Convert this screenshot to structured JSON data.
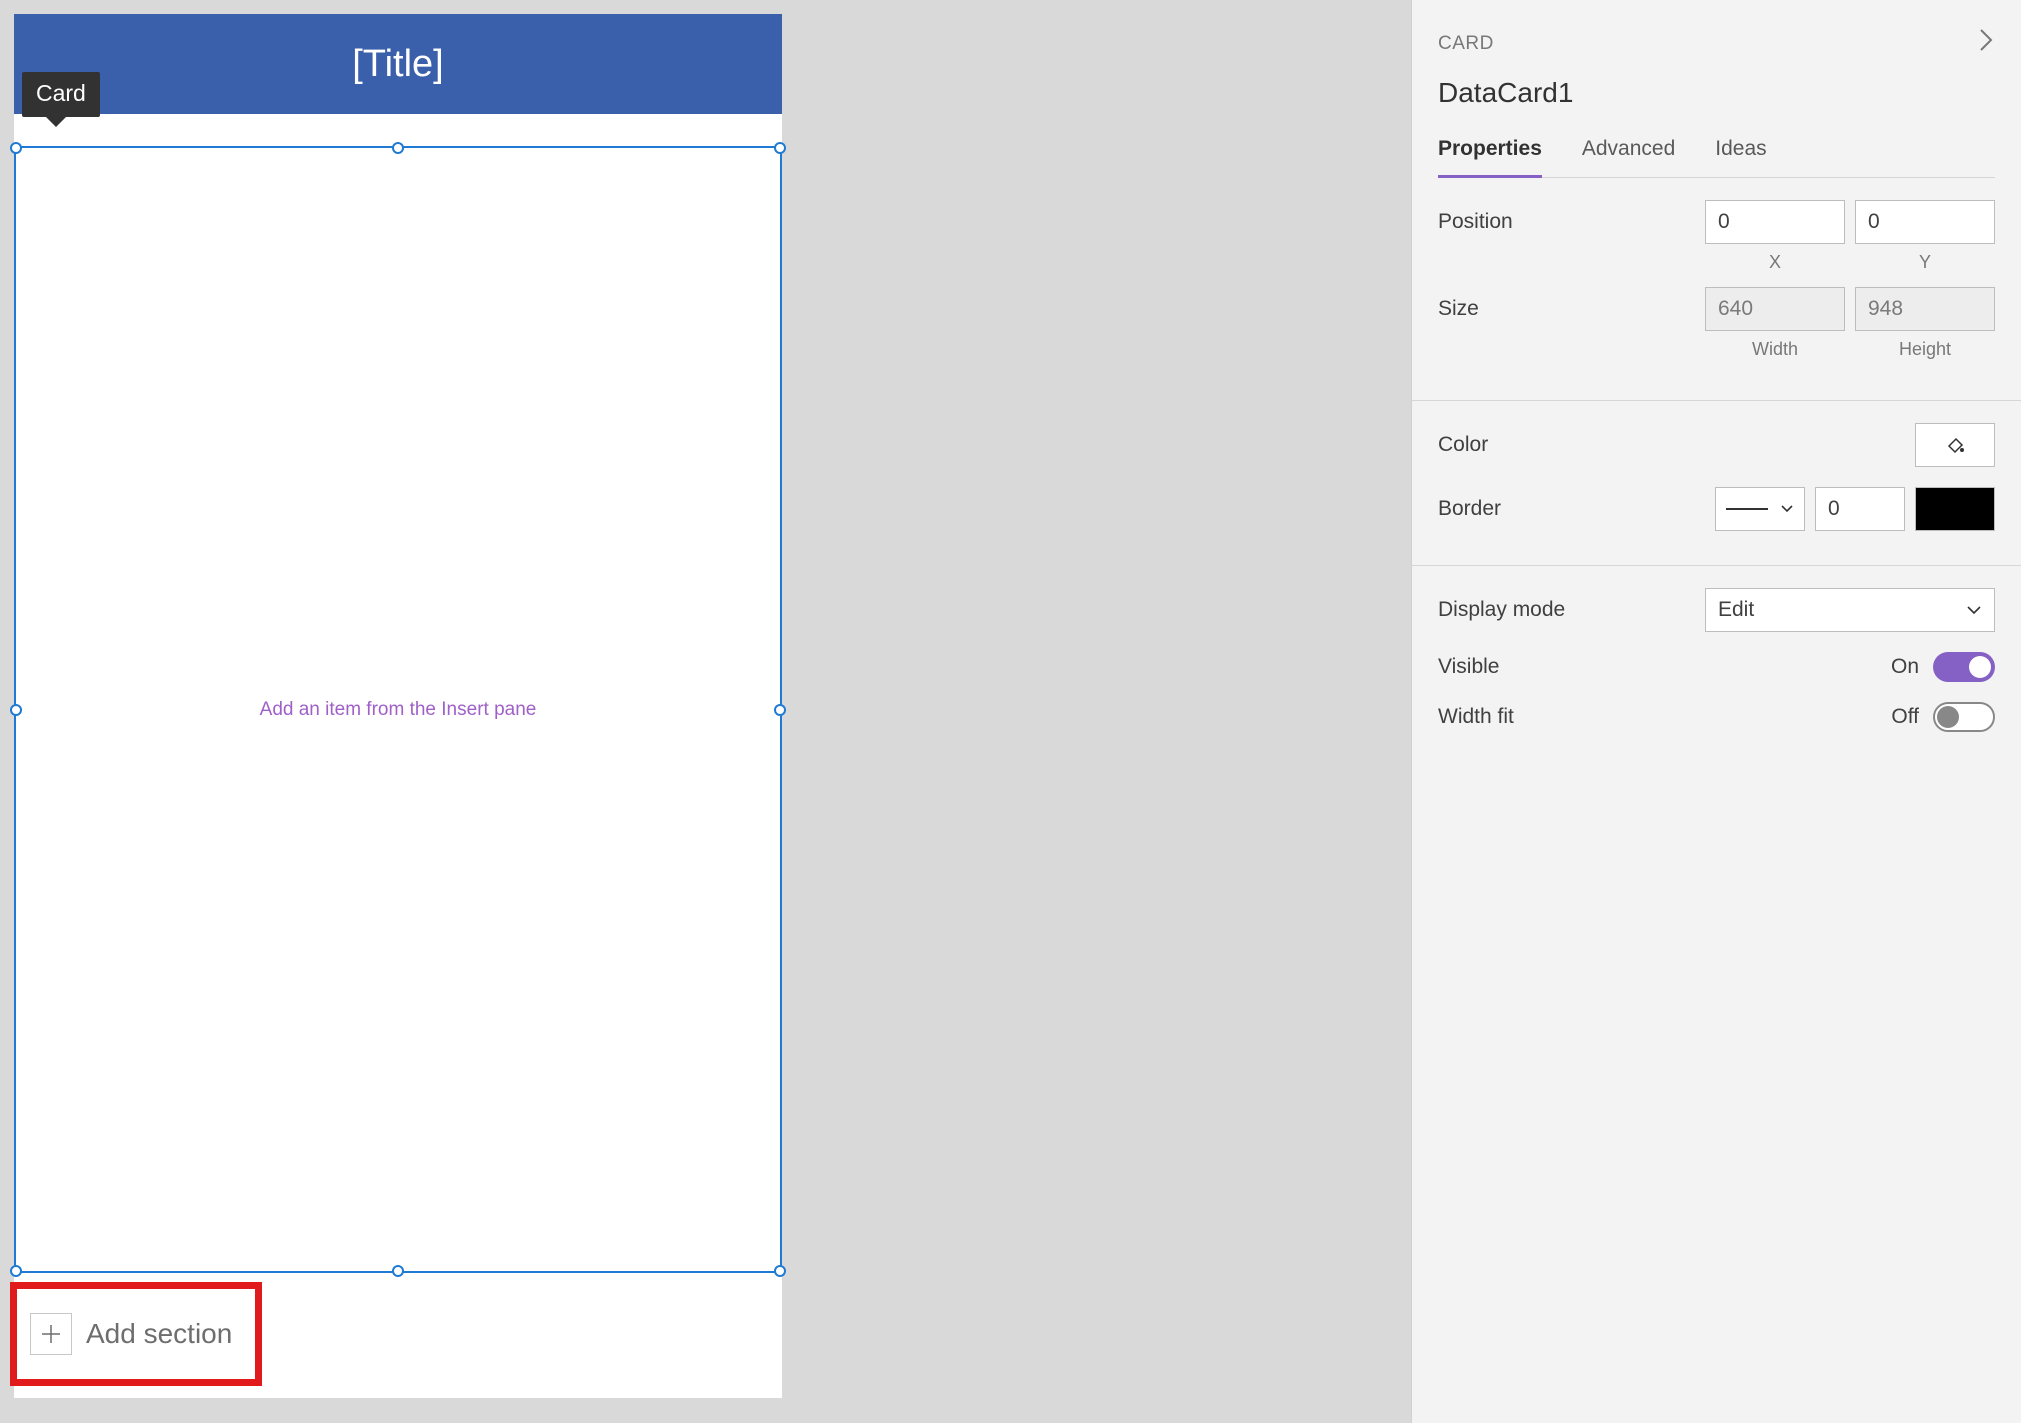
{
  "canvas": {
    "tooltip": "Card",
    "header_title": "[Title]",
    "empty_hint": "Add an item from the Insert pane",
    "add_section_label": "Add section"
  },
  "panel": {
    "crumb": "CARD",
    "title": "DataCard1",
    "tabs": {
      "properties": "Properties",
      "advanced": "Advanced",
      "ideas": "Ideas"
    },
    "groups": {
      "position": {
        "label": "Position",
        "x": "0",
        "y": "0",
        "x_label": "X",
        "y_label": "Y"
      },
      "size": {
        "label": "Size",
        "width": "640",
        "height": "948",
        "width_label": "Width",
        "height_label": "Height"
      },
      "color": {
        "label": "Color"
      },
      "border": {
        "label": "Border",
        "width": "0",
        "color": "#000000"
      },
      "display_mode": {
        "label": "Display mode",
        "value": "Edit"
      },
      "visible": {
        "label": "Visible",
        "text": "On",
        "on": true
      },
      "width_fit": {
        "label": "Width fit",
        "text": "Off",
        "on": false
      }
    }
  }
}
